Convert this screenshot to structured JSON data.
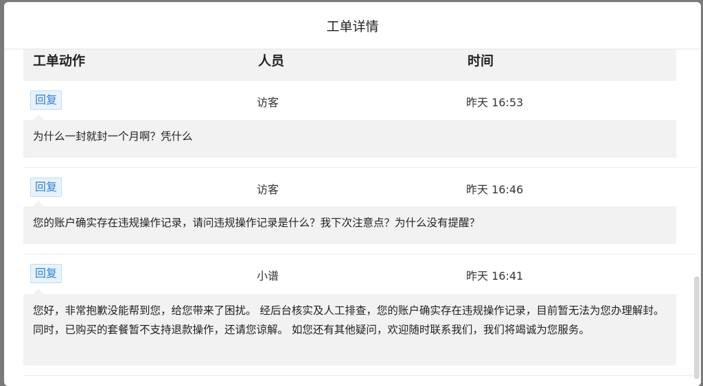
{
  "dialog": {
    "title": "工单详情"
  },
  "table": {
    "headers": {
      "action": "工单动作",
      "person": "人员",
      "time": "时间"
    },
    "rows": [
      {
        "action": "回复",
        "person": "访客",
        "time": "昨天 16:53",
        "message": "为什么一封就封一个月啊？凭什么"
      },
      {
        "action": "回复",
        "person": "访客",
        "time": "昨天 16:46",
        "message": "您的账户确实存在违规操作记录，请问违规操作记录是什么？我下次注意点？为什么没有提醒？"
      },
      {
        "action": "回复",
        "person": "小谱",
        "time": "昨天 16:41",
        "message": "您好，非常抱歉没能帮到您，给您带来了困扰。 经后台核实及人工排查，您的账户确实存在违规操作记录，目前暂无法为您办理解封。同时，已购买的套餐暂不支持退款操作，还请您谅解。 如您还有其他疑问，欢迎随时联系我们，我们将竭诚为您服务。"
      }
    ]
  }
}
